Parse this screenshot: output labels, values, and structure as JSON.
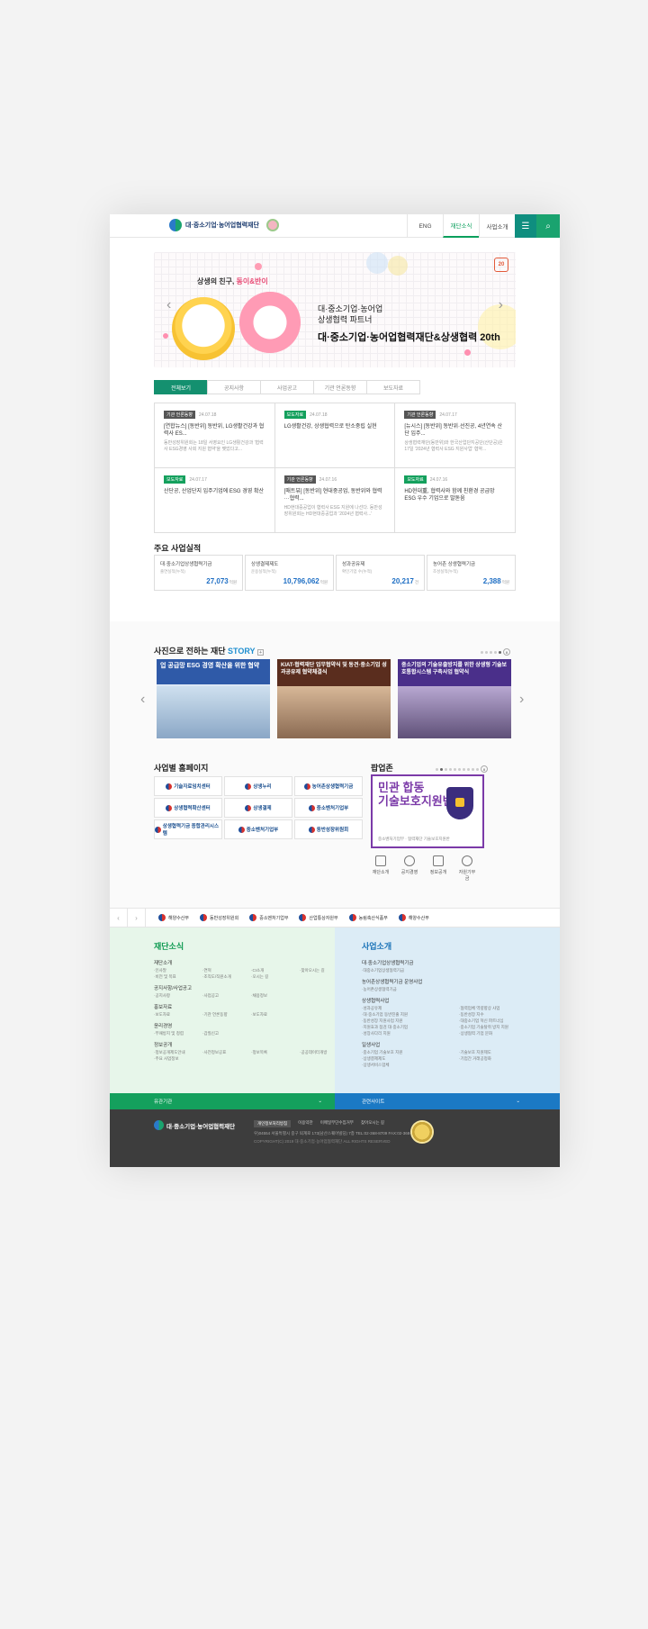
{
  "header": {
    "logo_text": "대·중소기업·농어업협력재단",
    "nav": [
      "ENG",
      "재단소식",
      "사업소개"
    ],
    "menu_icon": "menu-icon",
    "search_icon": "search-icon"
  },
  "banner": {
    "tagline_prefix": "상생의 친구, ",
    "tagline_em": "동이&반이",
    "line1": "대·중소기업·농어업",
    "line2": "상생협력 파트너",
    "line3": "대·중소기업·농어업협력재단&상생협력 20th",
    "badge": "20"
  },
  "tabs": [
    "전체보기",
    "공지사항",
    "사업공고",
    "기관 언론동향",
    "보도자료"
  ],
  "news": [
    {
      "tag": "기관 언론동향",
      "tagColor": "gray",
      "date": "24.07.18",
      "title": "[연합뉴스] [동반위] 동반위, LG생활건강과 협력사 ES...",
      "desc": "동반성장위원회는 18일 서영요인 LG생활건강과 '협력사 ESG경영 사회 지원 협약'을 맺었다고..."
    },
    {
      "tag": "보도자료",
      "tagColor": "green",
      "date": "24.07.18",
      "title": "LG생활건강, 상생협력으로 탄소중립 실현",
      "desc": ""
    },
    {
      "tag": "기관 언론동향",
      "tagColor": "gray",
      "date": "24.07.17",
      "title": "[뉴시스] [동반위] 동반위·선진공, 4년연속 산단 입주...",
      "desc": "상생협력재단(동반위)와 한국산업단지공단(산단공)은 17일 '2024년 협력사 ESG 지원사업' 협약..."
    },
    {
      "tag": "보도자료",
      "tagColor": "green",
      "date": "24.07.17",
      "title": "산단공, 산업단지 입주기업에 ESG 경영 확산",
      "desc": ""
    },
    {
      "tag": "기관 언론동향",
      "tagColor": "gray",
      "date": "24.07.16",
      "title": "[매트뷰] [동반위] 현대중공업, 동반위와 협력···협력...",
      "desc": "HD현대중공업이 협력사 ESG 지원에 나선다. 동반성장위원회는 HD현대중공업과 '2024년 협력사...'"
    },
    {
      "tag": "보도자료",
      "tagColor": "green",
      "date": "24.07.16",
      "title": "HD현대重, 협력사와 함께 친환경 공급망 ESG 우수 기업으로 발돋움",
      "desc": ""
    }
  ],
  "performance": {
    "title": "주요 사업실적",
    "items": [
      {
        "label": "대·중소기업상생협력기금",
        "sub": "출연실적(누적)",
        "value": "27,073",
        "unit": "억원"
      },
      {
        "label": "상생결제제도",
        "sub": "운용실적(누적)",
        "value": "10,796,062",
        "unit": "억원"
      },
      {
        "label": "성과공유제",
        "sub": "확인기업 수(누적)",
        "value": "20,217",
        "unit": "건"
      },
      {
        "label": "농어촌 상생협력기금",
        "sub": "조성실적(누적)",
        "value": "2,388",
        "unit": "억원"
      }
    ]
  },
  "story": {
    "title_prefix": "사진으로 전하는 재단 ",
    "title_em": "STORY",
    "photos": [
      {
        "banner": "업 공급망 ESG 경영 확산을 위한 협약",
        "color": "#2f5aa8"
      },
      {
        "banner": "KIAT-협력재단 업무협약식 및 동견·중소기업 성과공유제 협약체결식",
        "color": "#5a2d1e"
      },
      {
        "banner": "중소기업의 기술유출방지를 위한 상생형 기술보호통합시스템 구축사업 협약식",
        "color": "#4a2f8a"
      }
    ]
  },
  "homepages": {
    "title": "사업별 홈페이지",
    "items": [
      "기술자료임치센터",
      "상생누리",
      "농어촌상생협력기금",
      "상생협력확산센터",
      "상생결제",
      "중소벤처기업부",
      "상생협력기금 종합관리시스템",
      "중소벤처기업부",
      "동반성장위원회"
    ]
  },
  "popup": {
    "title": "팝업존",
    "headline1": "민관 합동",
    "headline2": "기술보호지원반",
    "footer": "중소벤처기업부 · 협력재단 기술보호지원반"
  },
  "quick": [
    "재단소개",
    "공지경영",
    "정보공개",
    "자원기부금"
  ],
  "related_orgs": [
    "해양수산부",
    "동반성장위원회",
    "중소벤처기업부",
    "산업통상자원부",
    "농림축산식품부",
    "해양수산부"
  ],
  "sitemap_left": {
    "title": "재단소식",
    "groups": [
      {
        "title": "재단소개",
        "items": [
          "·인사말",
          "·연혁",
          "·CI소개",
          "·찾아오시는 길",
          "·비전 및 목표",
          "·조직도/직원소개",
          "·오시는 길",
          ""
        ]
      },
      {
        "title": "공지사항/사업공고",
        "items": [
          "·공지사항",
          "·사업공고",
          "·채용정보",
          ""
        ]
      },
      {
        "title": "홍보자료",
        "items": [
          "·보도자료",
          "·기관 언론동향",
          "·보도자료",
          ""
        ]
      },
      {
        "title": "윤리경영",
        "items": [
          "·부패방지 및 청렴",
          "·갑질신고",
          "",
          ""
        ]
      },
      {
        "title": "정보공개",
        "items": [
          "·정보공개제도안내",
          "·사전정보공표",
          "·정보목록",
          "·공공데이터개방",
          "·주요 사업정보",
          "",
          "",
          ""
        ]
      }
    ]
  },
  "sitemap_right": {
    "title": "사업소개",
    "groups": [
      {
        "title": "대·중소기업상생협력기금",
        "items": [
          "·대중소기업상생협력기금",
          ""
        ]
      },
      {
        "title": "농어촌상생협력기금 운영사업",
        "items": [
          "·농어촌상생협력기금",
          ""
        ]
      },
      {
        "title": "상생협력사업",
        "items": [
          "·성과공유제",
          "·협력업체 역량향상 사업",
          "·대·중소기업 동반진출 지원",
          "·동반성장 지수",
          "·동반성장 지원사업 지원",
          "·대중소기업 혁신 파트너십",
          "·지원효과 점검 대·중소기업",
          "·중소기업 기술탈취 방지 지원",
          "·성장사다리 지원",
          "·상생협력 기업 문화"
        ]
      },
      {
        "title": "일생사업",
        "items": [
          "·중소기업 기술보호 지원",
          "·기술보호 지원제도",
          "·상생결제제도",
          "·기업간 거래공정화",
          "·상생서비스업체",
          ""
        ]
      }
    ]
  },
  "bars": {
    "left": "유관기관",
    "right": "관련사이트"
  },
  "footer": {
    "logo": "대·중소기업·농어업협력재단",
    "links": [
      "개인정보처리방침",
      "이용약관",
      "이메일무단수집거부",
      "찾아오시는 길"
    ],
    "address": "우)04554 서울특별시 중구 퇴계로 173(남산스퀘어빌딩) 7층  TEL:02-368-8709  FAX:02-368-8709",
    "copyright": "COPYRIGHT(C) 2019 대·중소기업·농어업협력재단 ALL RIGHTS RESERVED"
  },
  "colors": {
    "green": "#14a05d",
    "teal": "#0f8e7f",
    "blue": "#1f6fc4",
    "purple": "#7b3aa8"
  }
}
